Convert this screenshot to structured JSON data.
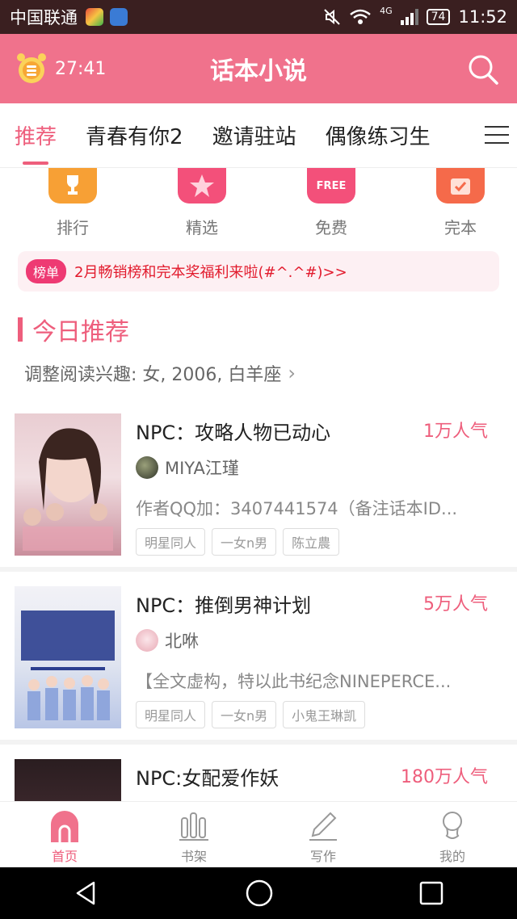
{
  "status": {
    "carrier": "中国联通",
    "network": "4G",
    "battery": "74",
    "time": "11:52"
  },
  "appbar": {
    "timer": "27:41",
    "title": "话本小说",
    "accent": "#f0728c"
  },
  "tabs": [
    "推荐",
    "青春有你2",
    "邀请驻站",
    "偶像练习生"
  ],
  "quick": [
    {
      "label": "排行",
      "icon": "trophy-icon",
      "color": "#f7a035"
    },
    {
      "label": "精选",
      "icon": "star-icon",
      "color": "#f3507a"
    },
    {
      "label": "免费",
      "icon": "free-icon",
      "color": "#f3507a",
      "badge": "FREE"
    },
    {
      "label": "完本",
      "icon": "check-icon",
      "color": "#f56a4a"
    }
  ],
  "notice": {
    "badge": "榜单",
    "text": "2月畅销榜和完本奖福利来啦(#^.^#)>>"
  },
  "section": {
    "title": "今日推荐",
    "interest": "调整阅读兴趣: 女, 2006, 白羊座"
  },
  "books": [
    {
      "title": "NPC：攻略人物已动心",
      "popularity": "1万人气",
      "author": "MIYA江瑾",
      "desc": "作者QQ加：3407441574（备注话本ID...",
      "tags": [
        "明星同人",
        "一女n男",
        "陈立農"
      ]
    },
    {
      "title": "NPC：推倒男神计划",
      "popularity": "5万人气",
      "author": "北咻",
      "desc": "【全文虚构，特以此书纪念NINEPERCE...",
      "tags": [
        "明星同人",
        "一女n男",
        "小鬼王琳凯"
      ]
    },
    {
      "title": "NPC:女配爱作妖",
      "popularity": "180万人气",
      "author": "",
      "desc": "",
      "tags": []
    }
  ],
  "bottomnav": [
    {
      "label": "首页",
      "icon": "home-icon",
      "active": true
    },
    {
      "label": "书架",
      "icon": "bookshelf-icon",
      "active": false
    },
    {
      "label": "写作",
      "icon": "pen-icon",
      "active": false
    },
    {
      "label": "我的",
      "icon": "profile-icon",
      "active": false
    }
  ]
}
